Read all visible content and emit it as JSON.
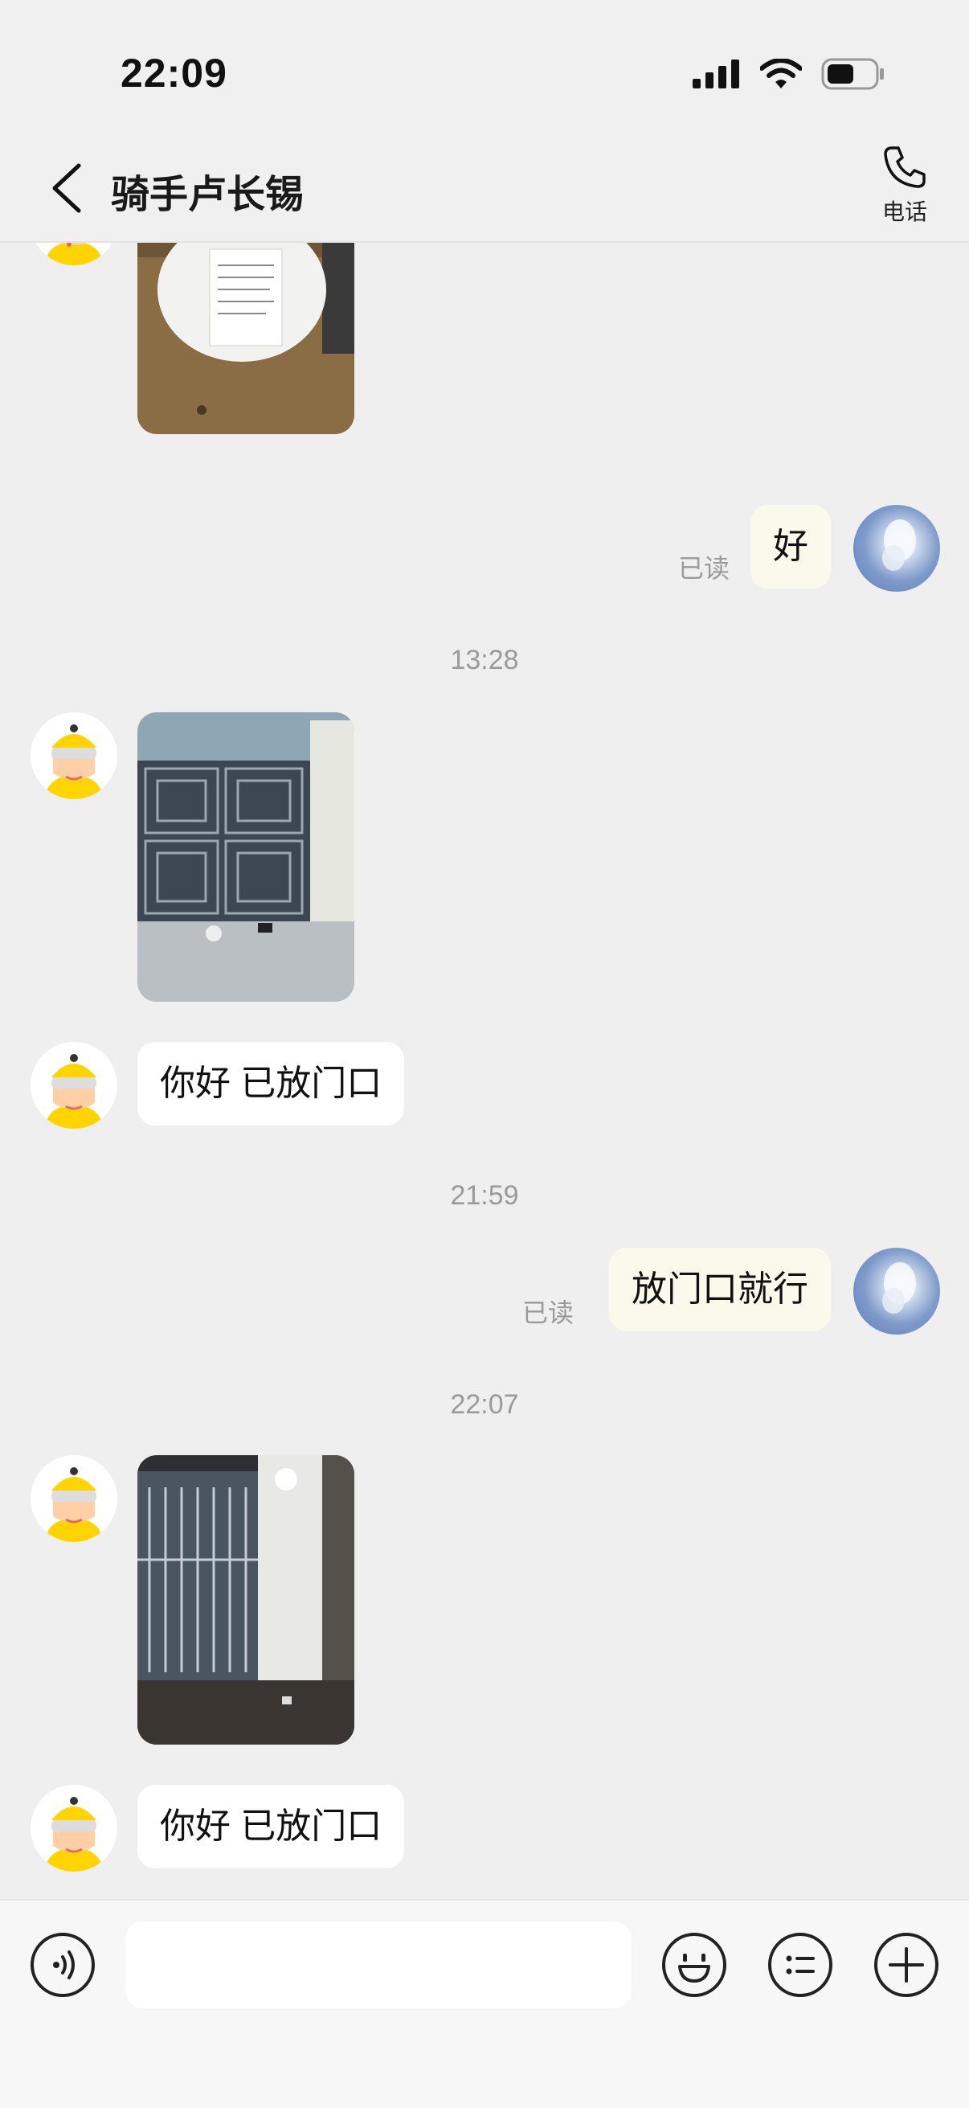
{
  "status_bar": {
    "time": "22:09"
  },
  "header": {
    "title": "骑手卢长锡",
    "call_label": "电话"
  },
  "messages": {
    "read_1": "已读",
    "reply_1": "好",
    "time_1": "13:28",
    "rider_text_1": "你好 已放门口",
    "time_2": "21:59",
    "read_2": "已读",
    "reply_2": "放门口就行",
    "time_3": "22:07",
    "rider_text_2": "你好 已放门口"
  },
  "input": {
    "placeholder": ""
  },
  "icons": {
    "back": "chevron-left-icon",
    "call": "phone-icon",
    "voice": "voice-icon",
    "emoji": "smile-icon",
    "quick_reply": "list-icon",
    "more": "plus-icon"
  },
  "colors": {
    "background": "#efefef",
    "outgoing_bubble": "#fbf9ec",
    "incoming_bubble": "#ffffff",
    "rider_yellow": "#ffd400"
  }
}
